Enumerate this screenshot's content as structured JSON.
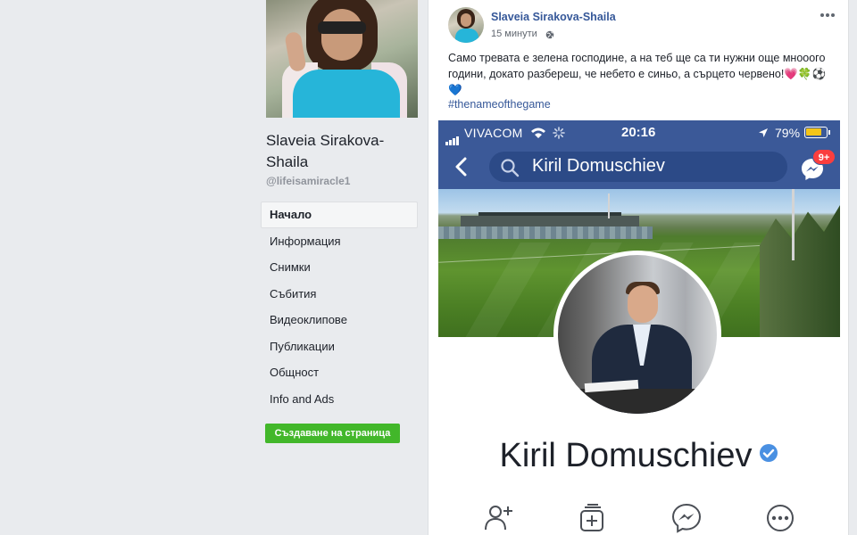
{
  "page": {
    "name": "Slaveia Sirakova-Shaila",
    "handle": "@lifeisamiracle1",
    "nav": [
      {
        "label": "Начало",
        "active": true
      },
      {
        "label": "Информация"
      },
      {
        "label": "Снимки"
      },
      {
        "label": "Събития"
      },
      {
        "label": "Видеоклипове"
      },
      {
        "label": "Публикации"
      },
      {
        "label": "Общност"
      },
      {
        "label": "Info and Ads"
      }
    ],
    "create_page_label": "Създаване на страница",
    "create_page_color": "#42b72a"
  },
  "post": {
    "author": "Slaveia Sirakova-Shaila",
    "time": "15 минути",
    "privacy_icon": "globe-icon",
    "menu_icon": "more-icon",
    "text": "Само тревата е зелена господине, а на теб ще са ти нужни още мнооого години, докато разбереш, че небето е синьо, а сърцето червено!💗🍀⚽💙",
    "hashtag": "#thenameofthegame",
    "link_color": "#365899"
  },
  "screenshot": {
    "carrier": "VIVACOM",
    "time": "20:16",
    "battery": "79%",
    "battery_level": 0.79,
    "search_query": "Kiril Domuschiev",
    "messenger_badge": "9+",
    "profile_name": "Kiril Domuschiev",
    "brand_color": "#3b5998",
    "actions": [
      "add-friend-icon",
      "add-to-list-icon",
      "messenger-icon",
      "more-options-icon"
    ]
  }
}
